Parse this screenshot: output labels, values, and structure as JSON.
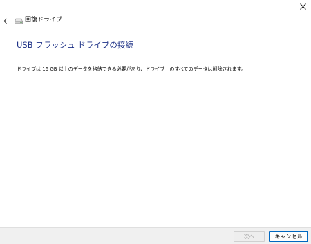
{
  "window": {
    "title": "回復ドライブ",
    "close_icon": "close-icon",
    "back_icon": "back-arrow-icon",
    "drive_icon": "drive-icon"
  },
  "page": {
    "heading": "USB フラッシュ ドライブの接続",
    "description": "ドライブは 16 GB 以上のデータを格納できる必要があり、ドライブ上のすべてのデータは削除されます。"
  },
  "footer": {
    "next_label": "次へ",
    "next_enabled": false,
    "cancel_label": "キャンセル"
  },
  "colors": {
    "heading": "#1e3287",
    "accent_border": "#0067c0",
    "footer_bg": "#f0f0f0",
    "disabled_text": "#a8a8a8"
  }
}
